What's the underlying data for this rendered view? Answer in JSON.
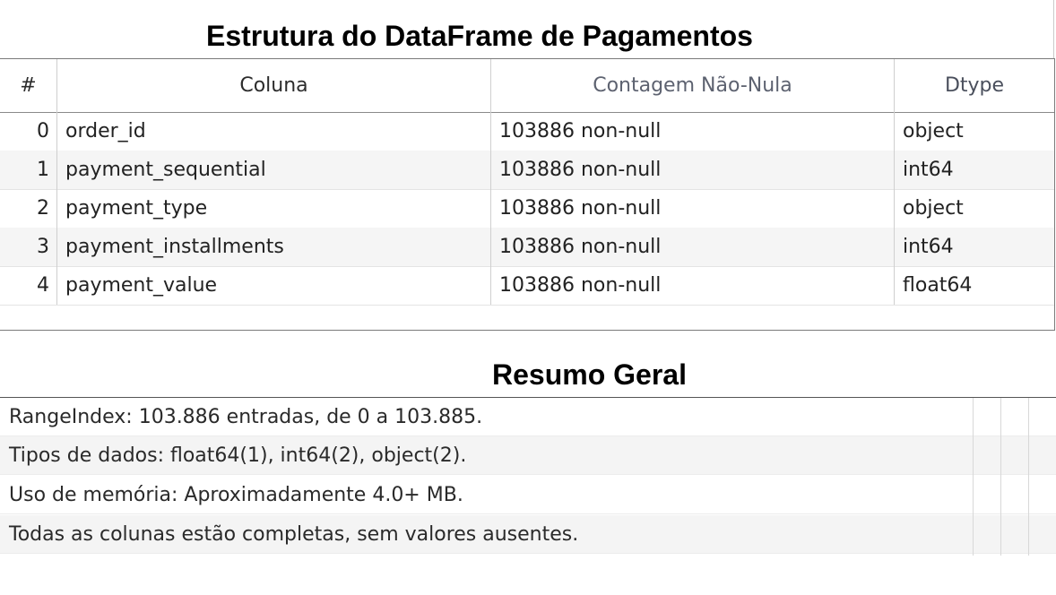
{
  "structure": {
    "title": "Estrutura do DataFrame de Pagamentos",
    "headers": {
      "index": "#",
      "column": "Coluna",
      "count": "Contagem Não-Nula",
      "dtype": "Dtype"
    },
    "rows": [
      {
        "index": "0",
        "column": "order_id",
        "count": "103886 non-null",
        "dtype": "object"
      },
      {
        "index": "1",
        "column": "payment_sequential",
        "count": "103886 non-null",
        "dtype": "int64"
      },
      {
        "index": "2",
        "column": "payment_type",
        "count": "103886 non-null",
        "dtype": "object"
      },
      {
        "index": "3",
        "column": "payment_installments",
        "count": "103886 non-null",
        "dtype": "int64"
      },
      {
        "index": "4",
        "column": "payment_value",
        "count": "103886 non-null",
        "dtype": "float64"
      }
    ]
  },
  "summary": {
    "title": "Resumo Geral",
    "lines": [
      "RangeIndex: 103.886 entradas, de 0 a 103.885.",
      "Tipos de dados: float64(1), int64(2), object(2).",
      "Uso de memória: Aproximadamente 4.0+ MB.",
      "Todas as colunas estão completas, sem valores ausentes."
    ]
  }
}
